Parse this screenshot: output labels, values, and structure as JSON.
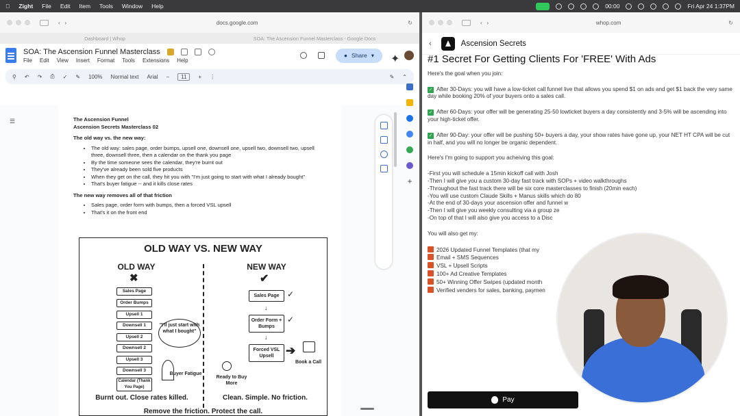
{
  "menubar": {
    "app_name": "Zight",
    "items": [
      "File",
      "Edit",
      "Item",
      "Tools",
      "Window",
      "Help"
    ],
    "timer": "00:00",
    "datetime": "Fri Apr 24  1:37PM"
  },
  "left_window": {
    "url": "docs.google.com",
    "tabs": [
      "Dashboard | Whop",
      "SOA: The Ascension Funnel Masterclass - Google Docs"
    ],
    "doc_title": "SOA: The Ascension Funnel Masterclass",
    "menu": [
      "File",
      "Edit",
      "View",
      "Insert",
      "Format",
      "Tools",
      "Extensions",
      "Help"
    ],
    "share_label": "Share",
    "toolbar": {
      "zoom": "100%",
      "style": "Normal text",
      "font": "Arial",
      "size": "11"
    },
    "doc": {
      "title1": "The Ascension Funnel",
      "title2": "Ascension Secrets Masterclass 02",
      "heading1": "The old way vs. the new way:",
      "old_bullets": [
        "The old way: sales page, order bumps, upsell one, downsell one, upsell two, downsell two, upsell three, downsell three, then a calendar on the thank you page",
        "By the time someone sees the calendar, they're burnt out",
        "They've already been sold five products",
        "When they get on the call, they hit you with \"I'm just going to start with what I already bought\"",
        "That's buyer fatigue -- and it kills close rates"
      ],
      "heading2": "The new way removes all of that friction",
      "new_bullets": [
        "Sales page, order form with bumps, then a forced VSL upsell",
        "That's it on the front end"
      ]
    },
    "figure": {
      "title": "OLD WAY VS. NEW WAY",
      "old_head": "OLD WAY",
      "new_head": "NEW WAY",
      "old_steps": [
        "Sales Page",
        "Order Bumps",
        "Upsell 1",
        "Downsell 1",
        "Upsell 2",
        "Downsell 2",
        "Upsell 3",
        "Downsell 3",
        "Calendar (Thank You Page)"
      ],
      "new_steps": [
        "Sales Page",
        "Order Form + Bumps",
        "Forced VSL Upsell"
      ],
      "bubble": "\"I'll just start with what I bought\"",
      "buyer_fatigue": "Buyer Fatigue",
      "ready": "Ready to Buy More",
      "book_call": "Book a Call",
      "old_caption": "Burnt out. Close rates killed.",
      "new_caption": "Clean. Simple. No friction.",
      "footer": "Remove the friction. Protect the call."
    }
  },
  "right_window": {
    "url": "whop.com",
    "brand": "Ascension Secrets",
    "heading": "#1 Secret For Getting Clients For 'FREE' With Ads",
    "goal_intro": "Here's the goal when you join:",
    "goals": [
      "After 30-Days: you will have a low-ticket call funnel live that allows you spend $1 on ads and get $1 back the very same day while booking 20% of your buyers onto a sales call.",
      "After 60-Days: your offer will be generating 25-50 lowticket buyers a day consistently and 3-5% will be ascending into your high-ticket offer.",
      "After 90-Day: your offer will be pushing 50+ buyers a day, your show rates have gone up, your NET HT CPA will be cut in half, and you will no longer be organic dependent."
    ],
    "support_intro": "Here's I'm going to support you acheiving this goal:",
    "support_lines": [
      "-First you will schedule a 15min kickoff call with Josh",
      "-Then I will give you a custom 30-day fast track with SOPs + video walkthroughs",
      "-Throughout the fast track there will be six core masterclasses to finish (20min each)",
      "-You will use custom Claude Skills + Manus skills which do 80",
      "-At the end of 30-days your ascension offer and funnel w",
      "-Then I will give you weekly consulting via a group ze",
      "-On top of that I will also give you access to a Disc"
    ],
    "also_intro": "You will also get my:",
    "also_items": [
      "2026 Updated Funnel Templates (that my",
      "Email + SMS Sequences",
      "VSL + Upsell Scripts",
      "100+ Ad Creative Templates",
      "50+ Winning Offer Swipes (updated month",
      "Verified venders for sales, banking, paymen"
    ],
    "pay_label": "Pay"
  }
}
